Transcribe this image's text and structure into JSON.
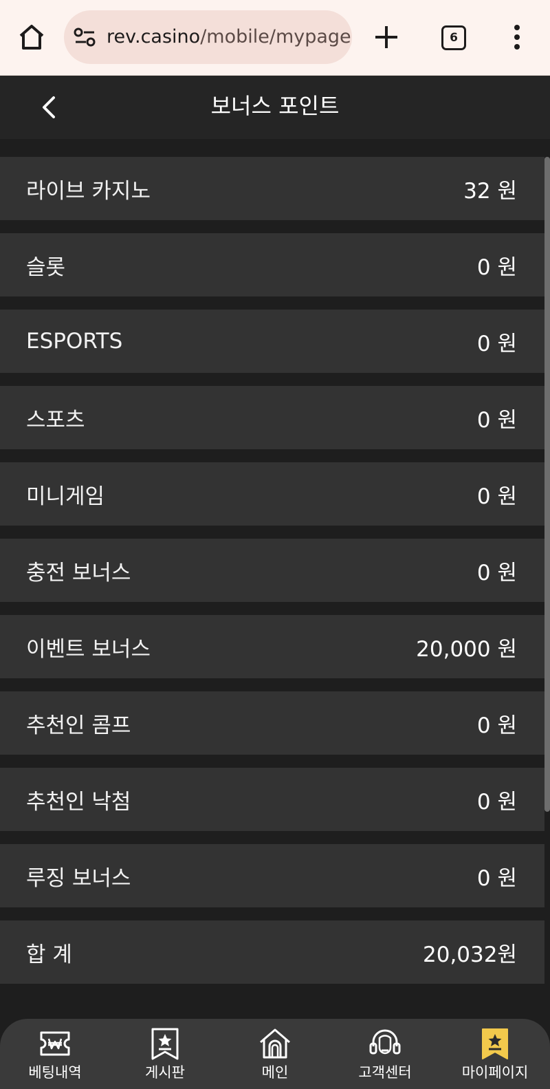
{
  "browser": {
    "url_host": "rev.casino",
    "url_path": "/mobile/mypage/l",
    "tab_count": "6"
  },
  "header": {
    "title": "보너스 포인트"
  },
  "rows": [
    {
      "label": "라이브 카지노",
      "value": "32 원"
    },
    {
      "label": "슬롯",
      "value": "0 원"
    },
    {
      "label": "ESPORTS",
      "value": "0 원"
    },
    {
      "label": "스포츠",
      "value": "0 원"
    },
    {
      "label": "미니게임",
      "value": "0 원"
    },
    {
      "label": "충전 보너스",
      "value": "0 원"
    },
    {
      "label": "이벤트 보너스",
      "value": "20,000 원"
    },
    {
      "label": "추천인 콤프",
      "value": "0 원"
    },
    {
      "label": "추천인 낙첨",
      "value": "0 원"
    },
    {
      "label": "루징 보너스",
      "value": "0 원"
    },
    {
      "label": "합 계",
      "value": "20,032원"
    }
  ],
  "nav": [
    {
      "label": "베팅내역",
      "icon": "betting-ticket-icon"
    },
    {
      "label": "게시판",
      "icon": "board-bookmark-icon"
    },
    {
      "label": "메인",
      "icon": "home-icon"
    },
    {
      "label": "고객센터",
      "icon": "headset-icon"
    },
    {
      "label": "마이페이지",
      "icon": "mypage-bookmark-icon"
    }
  ],
  "colors": {
    "accent": "#f2c94c",
    "row_bg": "#333333",
    "page_bg": "#1e1e1e"
  }
}
